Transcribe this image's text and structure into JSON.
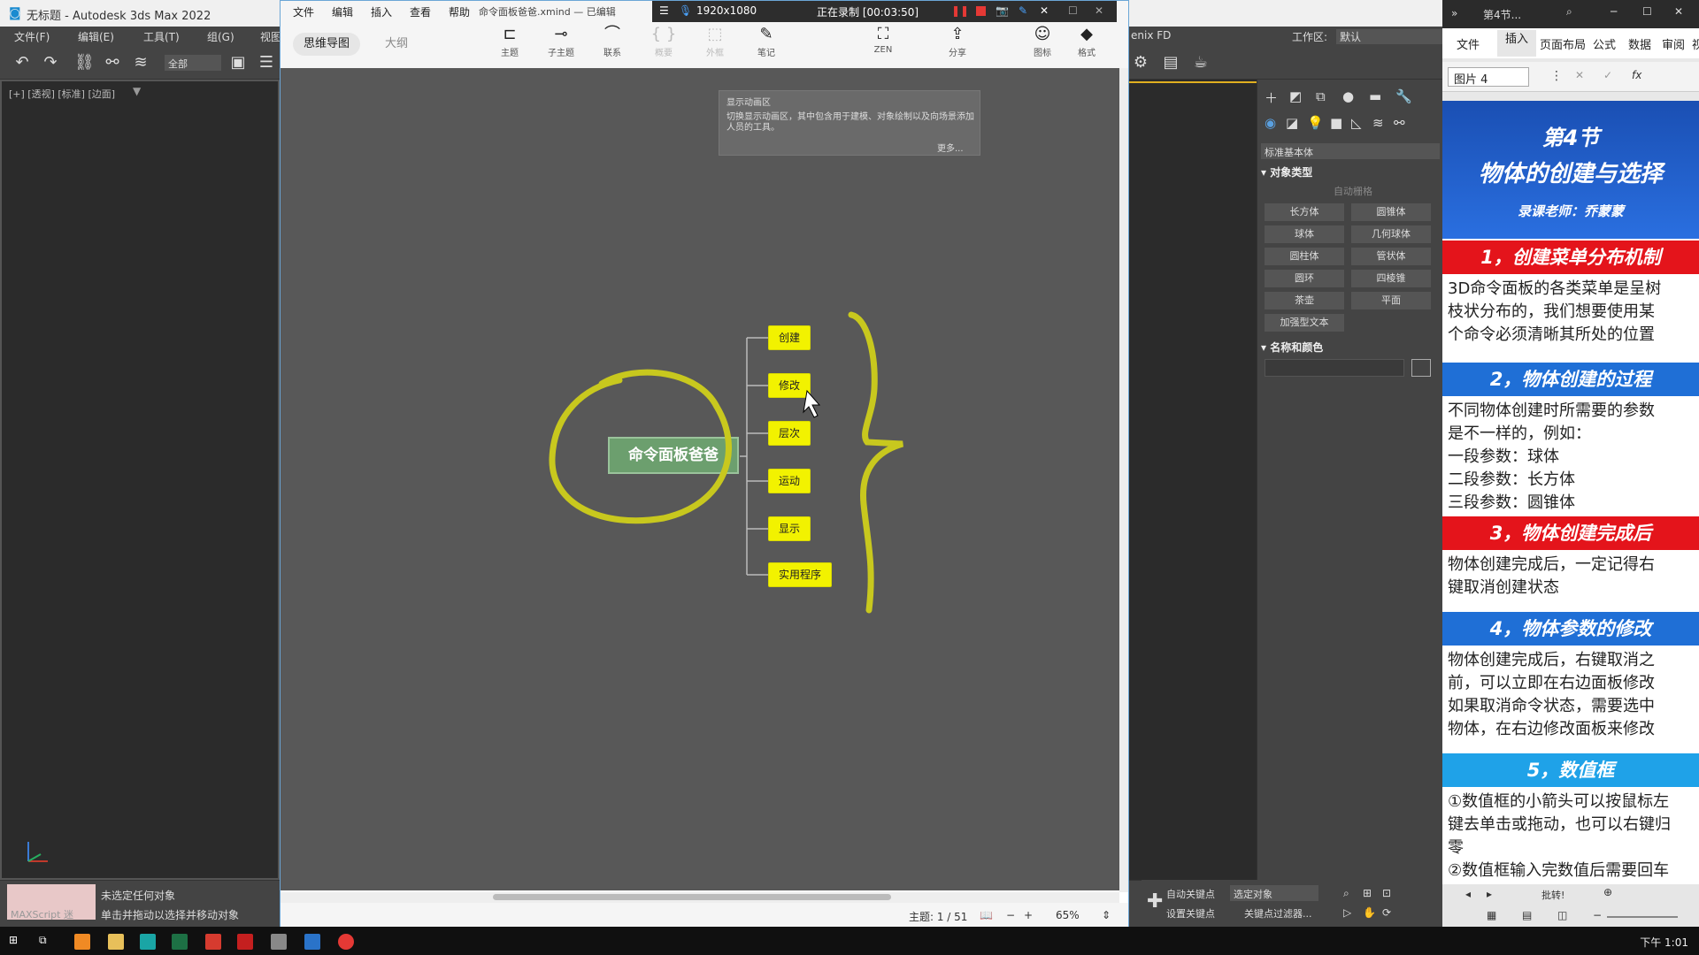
{
  "max": {
    "title": "无标题 - Autodesk 3ds Max 2022",
    "menu": [
      "文件(F)",
      "编辑(E)",
      "工具(T)",
      "组(G)",
      "视图"
    ],
    "right_menu_item": "enix FD",
    "workspace_label": "工作区:",
    "workspace_value": "默认",
    "selection_filter": "全部",
    "viewport_label": "[+] [透视] [标准] [边面]",
    "command_dropdown": "标准基本体",
    "object_type_title": "对象类型",
    "autogrid": "自动栅格",
    "object_buttons": [
      "长方体",
      "圆锥体",
      "球体",
      "几何球体",
      "圆柱体",
      "管状体",
      "圆环",
      "四棱锥",
      "茶壶",
      "平面",
      "加强型文本"
    ],
    "name_color_title": "名称和颜色",
    "maxscript": "MAXScript 迷",
    "status_1": "未选定任何对象",
    "status_2": "单击并拖动以选择并移动对象",
    "auto_key": "自动关键点",
    "set_key": "设置关键点",
    "selected_object": "选定对象",
    "key_filter": "关键点过滤器..."
  },
  "xmind": {
    "menu": [
      "文件",
      "编辑",
      "插入",
      "查看",
      "帮助"
    ],
    "filename": "命令面板爸爸.xmind — 已编辑",
    "recording": {
      "resolution": "1920x1080",
      "status": "正在录制 [00:03:50]"
    },
    "tabs": [
      "思维导图",
      "大纲"
    ],
    "tools": [
      {
        "label": "主题",
        "icon": "⊏"
      },
      {
        "label": "子主题",
        "icon": "⊸"
      },
      {
        "label": "联系",
        "icon": "⌒"
      },
      {
        "label": "概要",
        "icon": "{ }"
      },
      {
        "label": "外框",
        "icon": "⬚"
      },
      {
        "label": "笔记",
        "icon": "✎"
      },
      {
        "label": "ZEN",
        "icon": "⛶"
      },
      {
        "label": "分享",
        "icon": "⇪"
      },
      {
        "label": "图标",
        "icon": "☺"
      },
      {
        "label": "格式",
        "icon": "◆"
      }
    ],
    "tooltip": {
      "title": "显示动画区",
      "desc": "切换显示动画区，其中包含用于建模、对象绘制以及向场景添加人员的工具。",
      "more": "更多..."
    },
    "central_topic": "命令面板爸爸",
    "subtopics": [
      "创建",
      "修改",
      "层次",
      "运动",
      "显示",
      "实用程序"
    ],
    "status": {
      "topic_count": "主题: 1 / 51",
      "zoom": "65%"
    }
  },
  "ppt": {
    "window_title": "第4节...",
    "ribbon": [
      "文件",
      "插入",
      "页面布局",
      "公式",
      "数据",
      "审阅",
      "视"
    ],
    "namebox": "图片 4",
    "slide_title_1": "第4节",
    "slide_title_2": "物体的创建与选择",
    "slide_teacher": "录课老师：乔蒙蒙",
    "sections": [
      {
        "heading": "1，创建菜单分布机制",
        "color": "#e4141b",
        "body": [
          "3D命令面板的各类菜单是呈树",
          "枝状分布的，我们想要使用某",
          "个命令必须清晰其所处的位置"
        ]
      },
      {
        "heading": "2，物体创建的过程",
        "color": "#1f6fd6",
        "body": [
          "不同物体创建时所需要的参数",
          "是不一样的，例如：",
          "一段参数：球体",
          "二段参数：长方体",
          "三段参数：圆锥体"
        ]
      },
      {
        "heading": "3，物体创建完成后",
        "color": "#e4141b",
        "body": [
          "物体创建完成后，一定记得右",
          "键取消创建状态"
        ]
      },
      {
        "heading": "4，物体参数的修改",
        "color": "#1f6fd6",
        "body": [
          "物体创建完成后，右键取消之",
          "前，可以立即在右边面板修改",
          "如果取消命令状态，需要选中",
          "物体，在右边修改面板来修改"
        ]
      },
      {
        "heading": "5，数值框",
        "color": "#1f6fd6",
        "body": [
          "①数值框的小箭头可以按鼠标左",
          "键去单击或拖动，也可以右键归",
          "零",
          "②数值框输入完数值后需要回车"
        ]
      }
    ],
    "bottom": "批转!"
  },
  "taskbar": {
    "clock": "下午 1:01"
  }
}
